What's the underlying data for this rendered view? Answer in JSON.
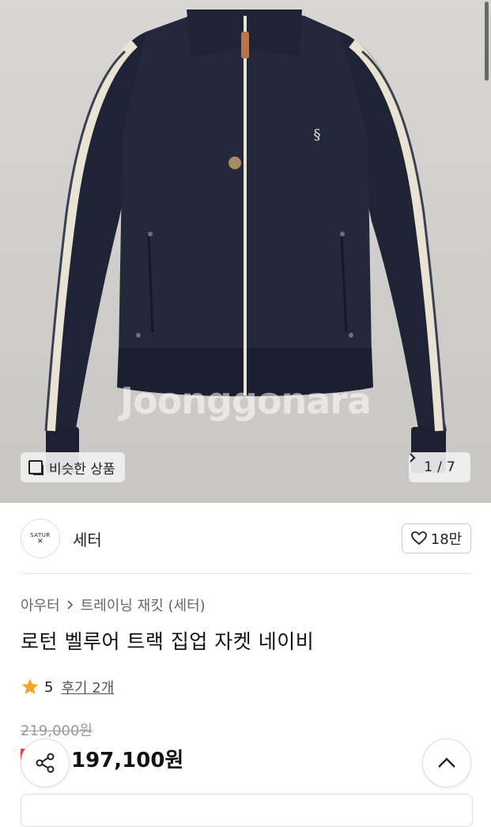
{
  "watermark": "Joonggonara",
  "gallery": {
    "similar_label": "비슷한 상품",
    "page_current": "1",
    "page_sep": "/",
    "page_total": "7"
  },
  "seller": {
    "logo_text": "SATUR",
    "name": "세터",
    "likes": "18만"
  },
  "breadcrumb": {
    "category": "아우터",
    "subcategory": "트레이닝 재킷 (세터)"
  },
  "product": {
    "title": "로턴 벨루어 트랙 집업 자켓 네이비",
    "rating": "5",
    "reviews": "후기 2개",
    "original_price": "219,000원",
    "price": "197,100원"
  },
  "colors": {
    "navy": "#1f2336",
    "cream": "#e8e3d3",
    "star": "#f5a623"
  },
  "icons": {
    "similar": "stacked-squares-icon",
    "pager": "chevron-right-icon",
    "like": "heart-icon",
    "star": "star-icon",
    "share": "share-icon",
    "top": "chevron-up-icon"
  }
}
